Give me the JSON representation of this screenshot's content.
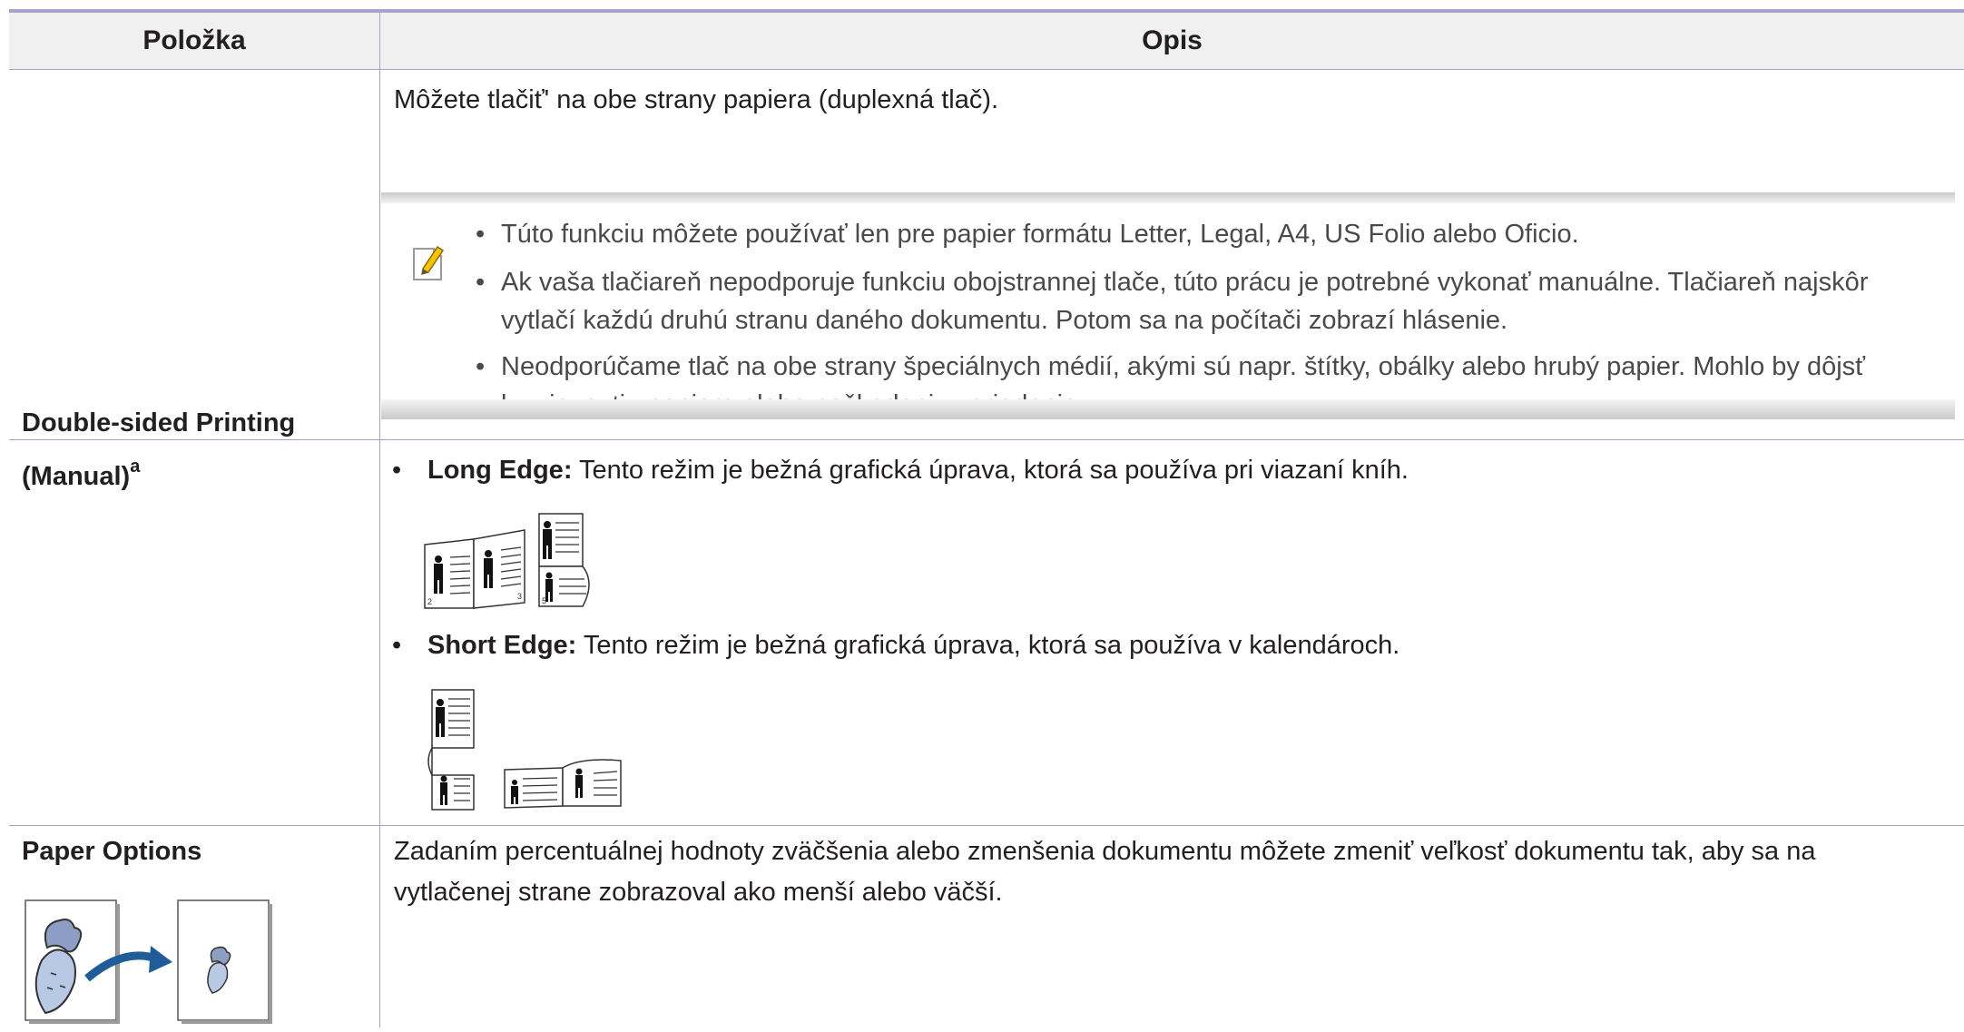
{
  "header": {
    "col1": "Položka",
    "col2": "Opis"
  },
  "row1": {
    "label_line1": "Double-sided Printing",
    "label_line2": "(Manual)",
    "label_sup": "a",
    "intro": "Môžete tlačiť' na obe strany papiera (duplexná tlač).",
    "note": {
      "items": [
        {
          "lines": [
            "Túto funkciu môžete používať len pre papier formátu Letter, Legal, A4, US Folio alebo Oficio."
          ]
        },
        {
          "lines": [
            "Ak vaša tlačiareň nepodporuje funkciu obojstrannej tlače, túto prácu je potrebné vykonať manuálne. Tlačiareň najskôr",
            "vytlačí každú druhú stranu daného dokumentu. Potom sa na počítači zobrazí hlásenie."
          ]
        },
        {
          "lines": [
            "Neodporúčame tlač na obe strany špeciálnych médií, akými sú napr. štítky, obálky alebo hrubý papier. Mohlo by dôjsť",
            "k uviaznutiu papiera alebo poškodeniu zariadenia."
          ]
        }
      ]
    },
    "long_edge": {
      "term": "Long Edge:",
      "desc": " Tento režim je bežná grafická úprava, ktorá sa používa pri viazaní kníh."
    },
    "short_edge": {
      "term": "Short Edge:",
      "desc": " Tento režim je bežná grafická úprava, ktorá sa používa v kalendároch."
    },
    "page_numbers": {
      "left": "2",
      "mid": "3",
      "right": "5"
    }
  },
  "row2": {
    "label": "Paper Options",
    "desc_line1": "Zadaním percentuálnej hodnoty zväčšenia alebo zmenšenia dokumentu môžete zmeniť veľkosť dokumentu tak, aby sa na",
    "desc_line2": "vytlačenej strane zobrazoval ako menší alebo väčší."
  },
  "colors": {
    "rule": "#a3a5c8",
    "header_bg": "#f0f0f0",
    "text": "#231f20",
    "note_text": "#4a4a4a",
    "arrow": "#1f5c99"
  }
}
